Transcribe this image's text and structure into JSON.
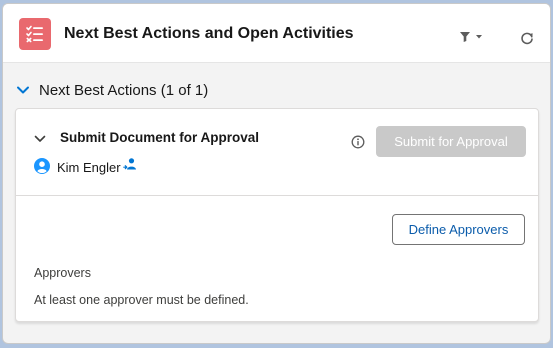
{
  "header": {
    "title": "Next Best Actions and Open Activities",
    "app_icon": "checklist-icon",
    "filter_icon": "filter-icon",
    "refresh_icon": "refresh-icon"
  },
  "section": {
    "label": "Next Best Actions (1 of 1)",
    "expanded": true
  },
  "card": {
    "title": "Submit Document for Approval",
    "assignee": "Kim Engler",
    "primary_button": "Submit for Approval",
    "primary_button_disabled": true,
    "secondary_button": "Define Approvers",
    "approvers_label": "Approvers",
    "approvers_message": "At least one approver must be defined."
  },
  "colors": {
    "accent": "#0176d3",
    "app_icon_bg": "#e9696e",
    "link_text": "#0b5cab",
    "disabled_button": "#c9c9c9"
  }
}
